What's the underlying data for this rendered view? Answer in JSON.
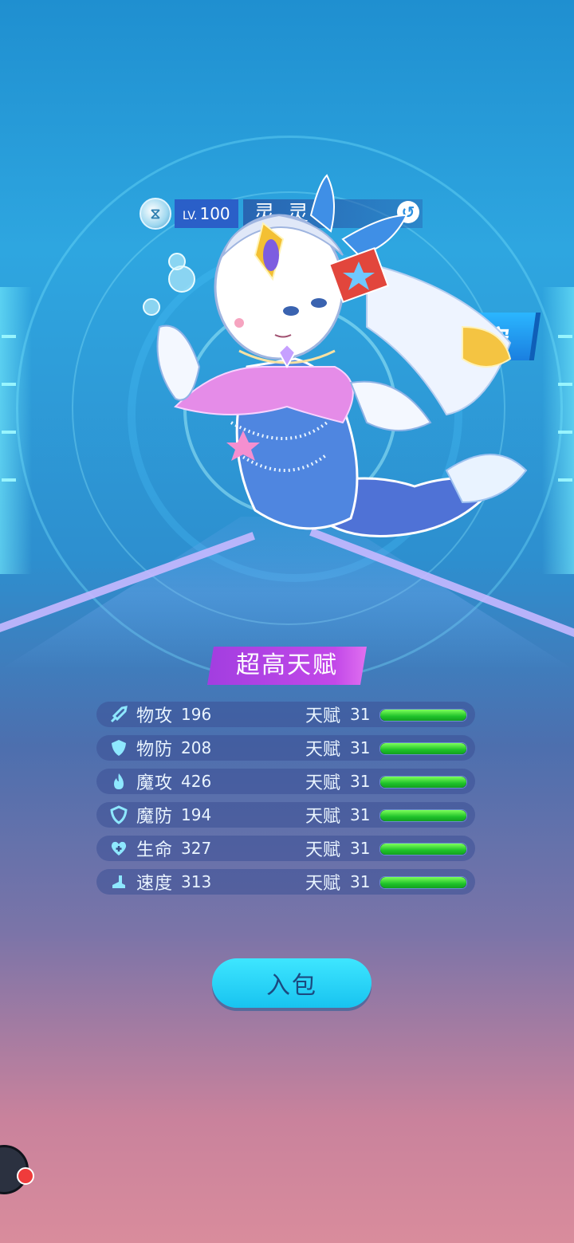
{
  "header": {
    "element_icon": "element-swirl-icon",
    "level_prefix": "LV.",
    "level": "100",
    "name": "灵 灵",
    "type_icon": "water-swirl-icon"
  },
  "personality_tag": "守",
  "talent_banner": "超高天赋",
  "stats": [
    {
      "icon": "sword-icon",
      "name": "物攻",
      "value": "196",
      "talent_label": "天赋",
      "talent": "31",
      "talent_fill": 1.0
    },
    {
      "icon": "shield-icon",
      "name": "物防",
      "value": "208",
      "talent_label": "天赋",
      "talent": "31",
      "talent_fill": 1.0
    },
    {
      "icon": "flame-icon",
      "name": "魔攻",
      "value": "426",
      "talent_label": "天赋",
      "talent": "31",
      "talent_fill": 1.0
    },
    {
      "icon": "magic-shield-icon",
      "name": "魔防",
      "value": "194",
      "talent_label": "天赋",
      "talent": "31",
      "talent_fill": 1.0
    },
    {
      "icon": "heart-plus-icon",
      "name": "生命",
      "value": "327",
      "talent_label": "天赋",
      "talent": "31",
      "talent_fill": 1.0
    },
    {
      "icon": "boot-icon",
      "name": "速度",
      "value": "313",
      "talent_label": "天赋",
      "talent": "31",
      "talent_fill": 1.0
    }
  ],
  "bag_button": "入包",
  "colors": {
    "accent": "#1fc7f2",
    "talent_bar": "#1fc22a",
    "banner": "#b443e6"
  }
}
